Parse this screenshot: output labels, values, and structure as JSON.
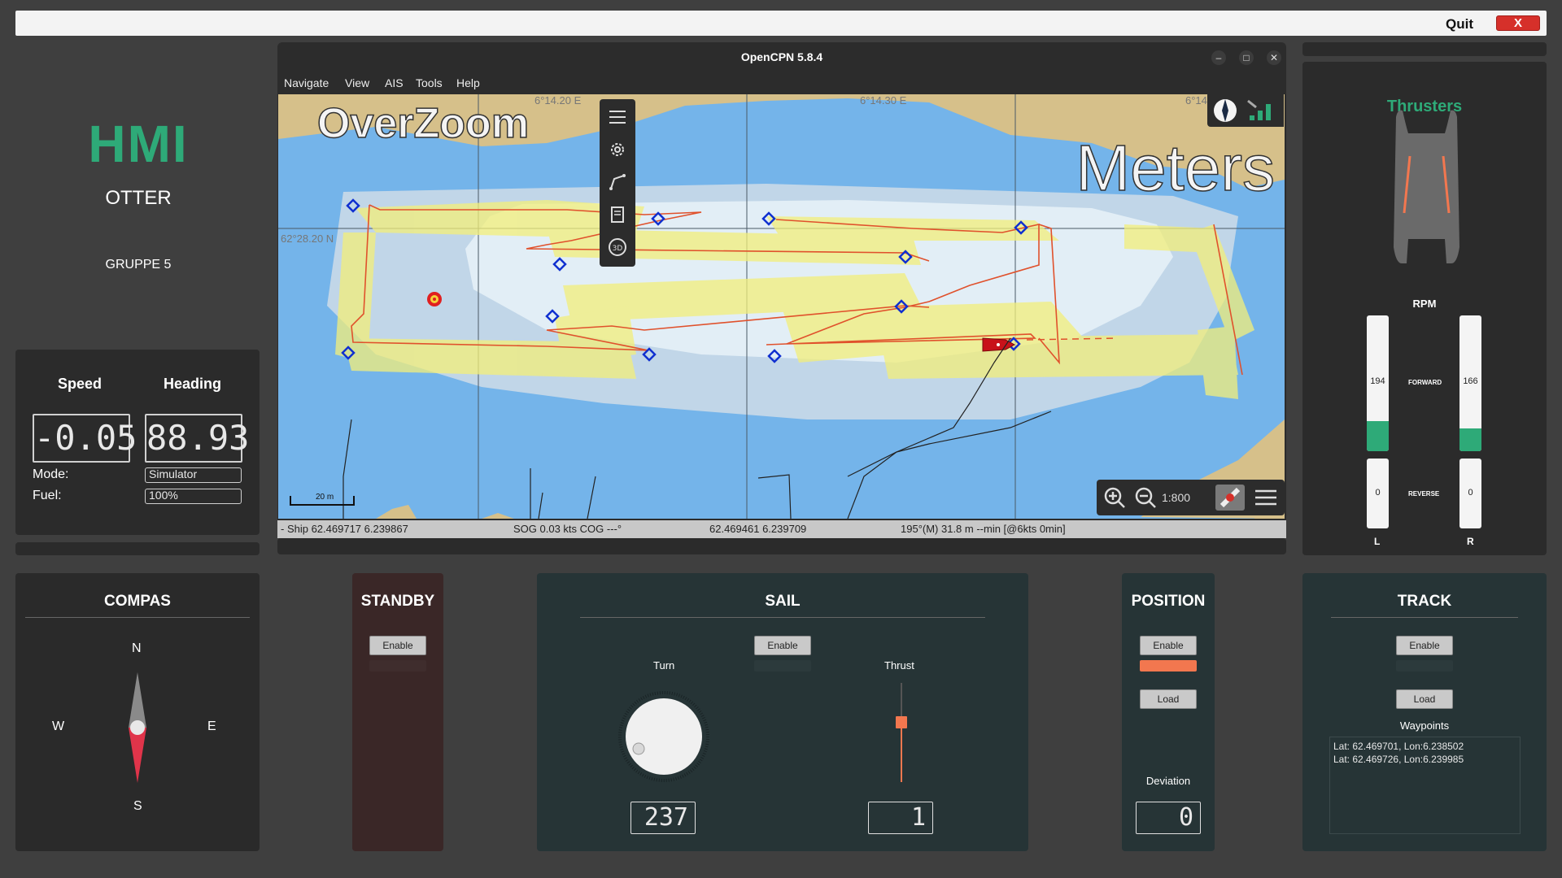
{
  "topbar": {
    "quit_label": "Quit",
    "close_label": "X"
  },
  "hmi": {
    "title": "HMI",
    "subtitle": "OTTER",
    "group": "GRUPPE 5"
  },
  "nav": {
    "speed_label": "Speed",
    "heading_label": "Heading",
    "speed_value": "-0.05",
    "heading_value": "88.93",
    "mode_label": "Mode:",
    "mode_value": "Simulator",
    "fuel_label": "Fuel:",
    "fuel_value": "100%"
  },
  "opencpn": {
    "title": "OpenCPN 5.8.4",
    "menu": [
      "Navigate",
      "View",
      "AIS",
      "Tools",
      "Help"
    ],
    "overlay_left": "OverZoom",
    "overlay_right": "Meters",
    "scale": "1:800",
    "scalebar": "20 m",
    "lon_ticks": [
      "6°14.20 E",
      "6°14.30 E",
      "6°14."
    ],
    "lat_tick": "62°28.20 N",
    "status": {
      "ship": "- Ship 62.469717   6.239867",
      "sog": "SOG 0.03 kts  COG ---°",
      "cursor": "62.469461   6.239709",
      "bearing": "195°(M)  31.8 m --min [@6kts 0min]"
    },
    "toolbar_icons": [
      "menu-icon",
      "gear-icon",
      "route-icon",
      "chart-page-icon",
      "3d-icon"
    ]
  },
  "thrusters": {
    "title": "Thrusters",
    "rpm_label": "RPM",
    "forward_label": "FORWARD",
    "reverse_label": "REVERSE",
    "left": {
      "label": "L",
      "forward": "194",
      "reverse": "0",
      "forward_fill": 0.22
    },
    "right": {
      "label": "R",
      "forward": "166",
      "reverse": "0",
      "forward_fill": 0.17
    }
  },
  "compass": {
    "title": "COMPAS",
    "n": "N",
    "s": "S",
    "e": "E",
    "w": "W"
  },
  "standby": {
    "title": "STANDBY",
    "enable": "Enable"
  },
  "sail": {
    "title": "SAIL",
    "enable": "Enable",
    "turn_label": "Turn",
    "thrust_label": "Thrust",
    "turn_value": "237",
    "thrust_value": "1"
  },
  "position": {
    "title": "POSITION",
    "enable": "Enable",
    "load": "Load",
    "deviation_label": "Deviation",
    "deviation_value": "0"
  },
  "track": {
    "title": "TRACK",
    "enable": "Enable",
    "load": "Load",
    "waypoints_label": "Waypoints",
    "waypoints": [
      "Lat: 62.469701,   Lon:6.238502",
      "Lat: 62.469726,   Lon:6.239985"
    ]
  },
  "colors": {
    "accent_green": "#2eaa78",
    "active_orange": "#f2774f",
    "quit_red": "#d6302a"
  }
}
